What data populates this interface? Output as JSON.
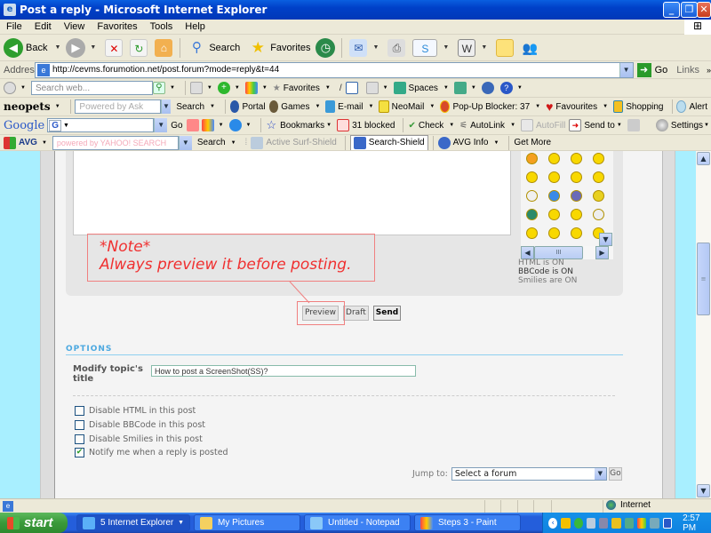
{
  "window": {
    "title": "Post a reply - Microsoft Internet Explorer",
    "controls": [
      "minimize",
      "restore",
      "close"
    ]
  },
  "menubar": {
    "items": [
      "File",
      "Edit",
      "View",
      "Favorites",
      "Tools",
      "Help"
    ]
  },
  "std_toolbar": {
    "back_label": "Back",
    "search_label": "Search",
    "favorites_label": "Favorites"
  },
  "address_bar": {
    "label": "Address",
    "url": "http://cevms.forumotion.net/post.forum?mode=reply&t=44",
    "go_label": "Go",
    "links_label": "Links"
  },
  "toolbar_msn": {
    "search_placeholder": "Search web...",
    "favorites_label": "Favorites",
    "spaces_label": "Spaces"
  },
  "toolbar_neopets": {
    "brand": "neopets",
    "search_placeholder": "Powered by Ask",
    "search_label": "Search",
    "portal_label": "Portal",
    "games_label": "Games",
    "email_label": "E-mail",
    "neomail_label": "NeoMail",
    "popup_blocker_label": "Pop-Up Blocker: 37",
    "favourites_label": "Favourites",
    "shopping_label": "Shopping",
    "alert_label": "Alert"
  },
  "toolbar_google": {
    "brand": "Google",
    "go_label": "Go",
    "bookmarks_label": "Bookmarks",
    "blocked_label": "31 blocked",
    "check_label": "Check",
    "autolink_label": "AutoLink",
    "autofill_label": "AutoFill",
    "sendto_label": "Send to",
    "settings_label": "Settings"
  },
  "toolbar_avg": {
    "brand": "AVG",
    "search_placeholder": "powered by YAHOO! SEARCH",
    "search_label": "Search",
    "active_shield_label": "Active  Surf-Shield",
    "search_shield_label": "Search-Shield",
    "avg_info_label": "AVG Info",
    "get_more_label": "Get More"
  },
  "post_form": {
    "message_value": "",
    "smilies": [
      "devil",
      "cool",
      "wink",
      "exclaim",
      "question",
      "idea",
      "blank",
      "neutral",
      "geek",
      "star",
      "ninja",
      "heart",
      "sick",
      "dizzy",
      "cyclops",
      "clown",
      "wink2",
      "tongue",
      "shocked",
      "sleepy"
    ],
    "status_lines": {
      "html": "HTML is ON",
      "bbcode": "BBCode is ON",
      "smilies": "Smilies are ON"
    },
    "annotation": {
      "line1": "*Note*",
      "line2": "Always preview it before posting."
    },
    "buttons": {
      "preview": "Preview",
      "draft": "Draft",
      "send": "Send"
    },
    "options_title": "OPTIONS",
    "topic_label": "Modify topic's title",
    "topic_value": "How to post a ScreenShot(SS)?",
    "checkboxes": [
      {
        "label": "Disable HTML in this post",
        "checked": false
      },
      {
        "label": "Disable BBCode in this post",
        "checked": false
      },
      {
        "label": "Disable Smilies in this post",
        "checked": false
      },
      {
        "label": "Notify me when a reply is posted",
        "checked": true
      }
    ],
    "jump_to_label": "Jump to:",
    "jump_to_value": "Select a forum",
    "jump_go_label": "Go"
  },
  "statusbar": {
    "zone": "Internet"
  },
  "taskbar": {
    "start_label": "start",
    "tasks": [
      {
        "label": "5 Internet Explorer",
        "count": "5",
        "active": true
      },
      {
        "label": "My Pictures",
        "active": false
      },
      {
        "label": "Untitled - Notepad",
        "active": false
      },
      {
        "label": "Steps 3 - Paint",
        "active": false
      }
    ],
    "clock": "2:57 PM"
  },
  "colors": {
    "annotation_red": "#f03030",
    "page_bg": "#a8efff",
    "options_blue": "#4ba8e0"
  }
}
